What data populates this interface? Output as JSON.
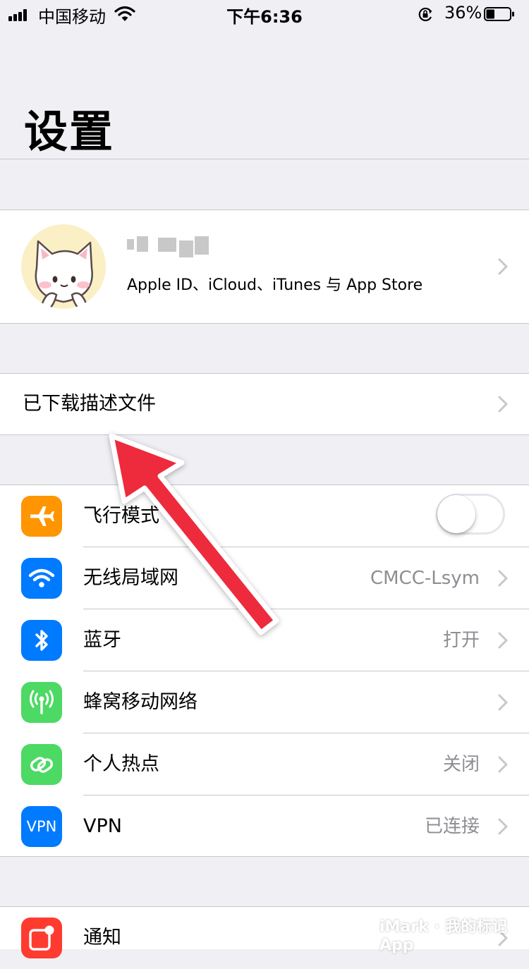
{
  "status_bar": {
    "carrier": "中国移动",
    "time": "下午6:36",
    "battery_percent": "36%",
    "battery_level": 0.36,
    "signal_icon": "cellular-signal-icon",
    "wifi_icon": "wifi-icon",
    "lock_icon": "orientation-lock-icon",
    "battery_icon": "battery-icon"
  },
  "header": {
    "title": "设置"
  },
  "profile": {
    "name_blurred": true,
    "subtitle": "Apple ID、iCloud、iTunes 与 App Store",
    "avatar_icon": "cartoon-cat-avatar"
  },
  "profiles_row": {
    "label": "已下载描述文件"
  },
  "settings_rows": [
    {
      "label": "飞行模式",
      "value": "",
      "icon": "airplane-icon",
      "color": "#ff9500",
      "toggle": true,
      "toggle_on": false
    },
    {
      "label": "无线局域网",
      "value": "CMCC-Lsym",
      "icon": "wifi-icon",
      "color": "#007aff"
    },
    {
      "label": "蓝牙",
      "value": "打开",
      "icon": "bluetooth-icon",
      "color": "#007aff"
    },
    {
      "label": "蜂窝移动网络",
      "value": "",
      "icon": "antenna-icon",
      "color": "#4cd964"
    },
    {
      "label": "个人热点",
      "value": "关闭",
      "icon": "hotspot-icon",
      "color": "#4cd964"
    },
    {
      "label": "VPN",
      "value": "已连接",
      "icon": "vpn-icon",
      "icon_text": "VPN",
      "color": "#007aff"
    }
  ],
  "notifications_row": {
    "label": "通知",
    "icon": "notifications-icon",
    "color": "#ff3b30"
  },
  "annotation": {
    "arrow_color": "#ee2a3c",
    "arrow_icon": "red-arrow-annotation"
  },
  "watermark": {
    "text": "iMark · 我的标记 App"
  }
}
